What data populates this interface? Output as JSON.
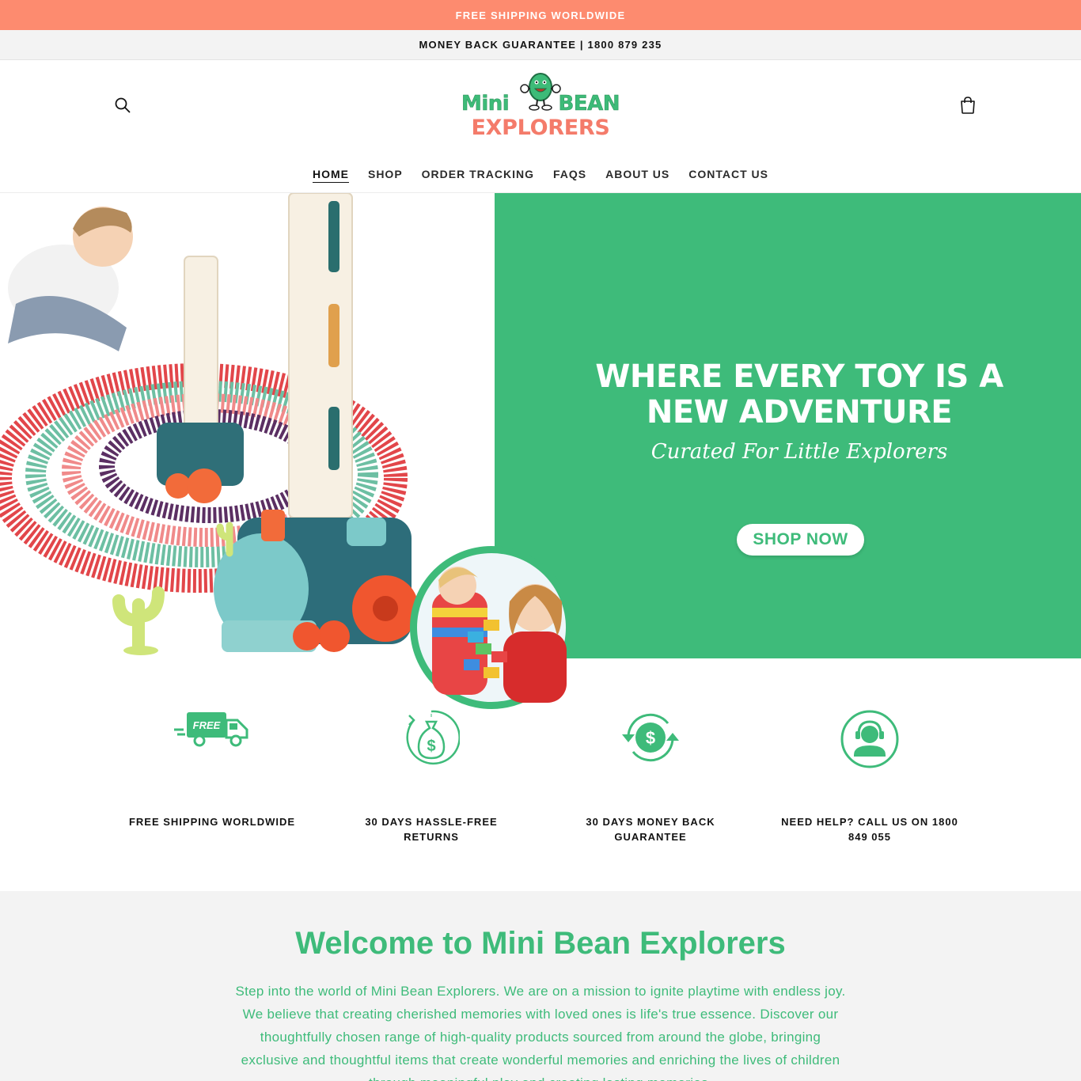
{
  "announcement": {
    "text": "FREE SHIPPING WORLDWIDE"
  },
  "subbar": {
    "text": "MONEY BACK GUARANTEE | 1800 879 235"
  },
  "header": {
    "logo": {
      "line1_left": "Mini",
      "line1_right": "BEAN",
      "line2": "EXPLORERS"
    },
    "search_icon": "search-icon",
    "cart_icon": "cart-icon"
  },
  "nav": {
    "items": [
      {
        "label": "HOME"
      },
      {
        "label": "SHOP"
      },
      {
        "label": "ORDER TRACKING"
      },
      {
        "label": "FAQS"
      },
      {
        "label": "ABOUT US"
      },
      {
        "label": "CONTACT US"
      }
    ]
  },
  "hero": {
    "title": "WHERE EVERY TOY IS A NEW ADVENTURE",
    "subtitle": "Curated For Little Explorers",
    "button": "SHOP NOW"
  },
  "features": [
    {
      "icon": "free-truck-icon",
      "label": "FREE SHIPPING WORLDWIDE",
      "badge": "FREE"
    },
    {
      "icon": "money-bag-return-icon",
      "label": "30 DAYS HASSLE-FREE RETURNS"
    },
    {
      "icon": "money-back-icon",
      "label": "30 DAYS MONEY BACK GUARANTEE"
    },
    {
      "icon": "support-agent-icon",
      "label": "NEED HELP? CALL US ON 1800 849 055"
    }
  ],
  "welcome": {
    "title": "Welcome to Mini Bean Explorers",
    "body": "Step into the world of Mini Bean Explorers. We are on a mission to ignite playtime with endless joy. We believe that creating cherished memories with loved ones is life's true essence. Discover our thoughtfully chosen range of high-quality products sourced from around the globe, bringing exclusive and thoughtful items that create wonderful memories and enriching the lives of children through meaningful play and creating lasting memories."
  },
  "colors": {
    "accent_green": "#3ebb7a",
    "coral": "#fd8b6f",
    "light_gray": "#f3f3f3"
  }
}
